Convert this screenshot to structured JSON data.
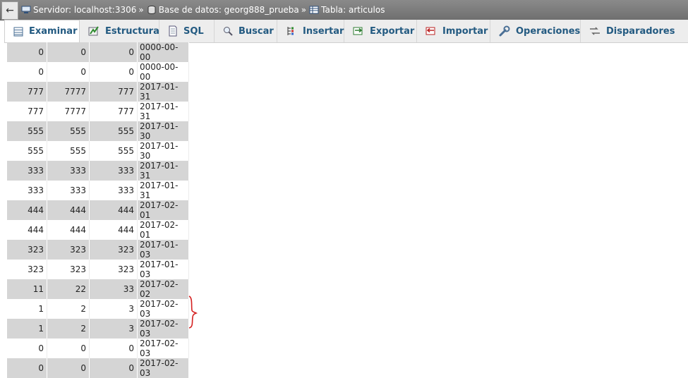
{
  "breadcrumb": {
    "back": "←",
    "items": [
      {
        "label": "Servidor: localhost:3306",
        "icon": "server-icon"
      },
      {
        "label": "Base de datos: georg888_prueba",
        "icon": "database-icon"
      },
      {
        "label": "Tabla: articulos",
        "icon": "table-icon"
      }
    ],
    "separator": "»"
  },
  "tabs": [
    {
      "label": "Examinar",
      "icon": "browse-icon",
      "active": true
    },
    {
      "label": "Estructura",
      "icon": "structure-icon"
    },
    {
      "label": "SQL",
      "icon": "sql-icon"
    },
    {
      "label": "Buscar",
      "icon": "search-icon"
    },
    {
      "label": "Insertar",
      "icon": "insert-icon"
    },
    {
      "label": "Exportar",
      "icon": "export-icon"
    },
    {
      "label": "Importar",
      "icon": "import-icon"
    },
    {
      "label": "Operaciones",
      "icon": "wrench-icon"
    },
    {
      "label": "Disparadores",
      "icon": "triggers-icon"
    }
  ],
  "rows": [
    [
      "0",
      "0",
      "0",
      "0000-00-00"
    ],
    [
      "0",
      "0",
      "0",
      "0000-00-00"
    ],
    [
      "777",
      "7777",
      "777",
      "2017-01-31"
    ],
    [
      "777",
      "7777",
      "777",
      "2017-01-31"
    ],
    [
      "555",
      "555",
      "555",
      "2017-01-30"
    ],
    [
      "555",
      "555",
      "555",
      "2017-01-30"
    ],
    [
      "333",
      "333",
      "333",
      "2017-01-31"
    ],
    [
      "333",
      "333",
      "333",
      "2017-01-31"
    ],
    [
      "444",
      "444",
      "444",
      "2017-02-01"
    ],
    [
      "444",
      "444",
      "444",
      "2017-02-01"
    ],
    [
      "323",
      "323",
      "323",
      "2017-01-03"
    ],
    [
      "323",
      "323",
      "323",
      "2017-01-03"
    ],
    [
      "11",
      "22",
      "33",
      "2017-02-02"
    ],
    [
      "1",
      "2",
      "3",
      "2017-02-03"
    ],
    [
      "1",
      "2",
      "3",
      "2017-02-03"
    ],
    [
      "0",
      "0",
      "0",
      "2017-02-03"
    ],
    [
      "0",
      "0",
      "0",
      "2017-02-03"
    ]
  ],
  "colors": {
    "accent": "#235a81",
    "annotation": "#d42020",
    "row_odd": "#d5d5d5"
  }
}
